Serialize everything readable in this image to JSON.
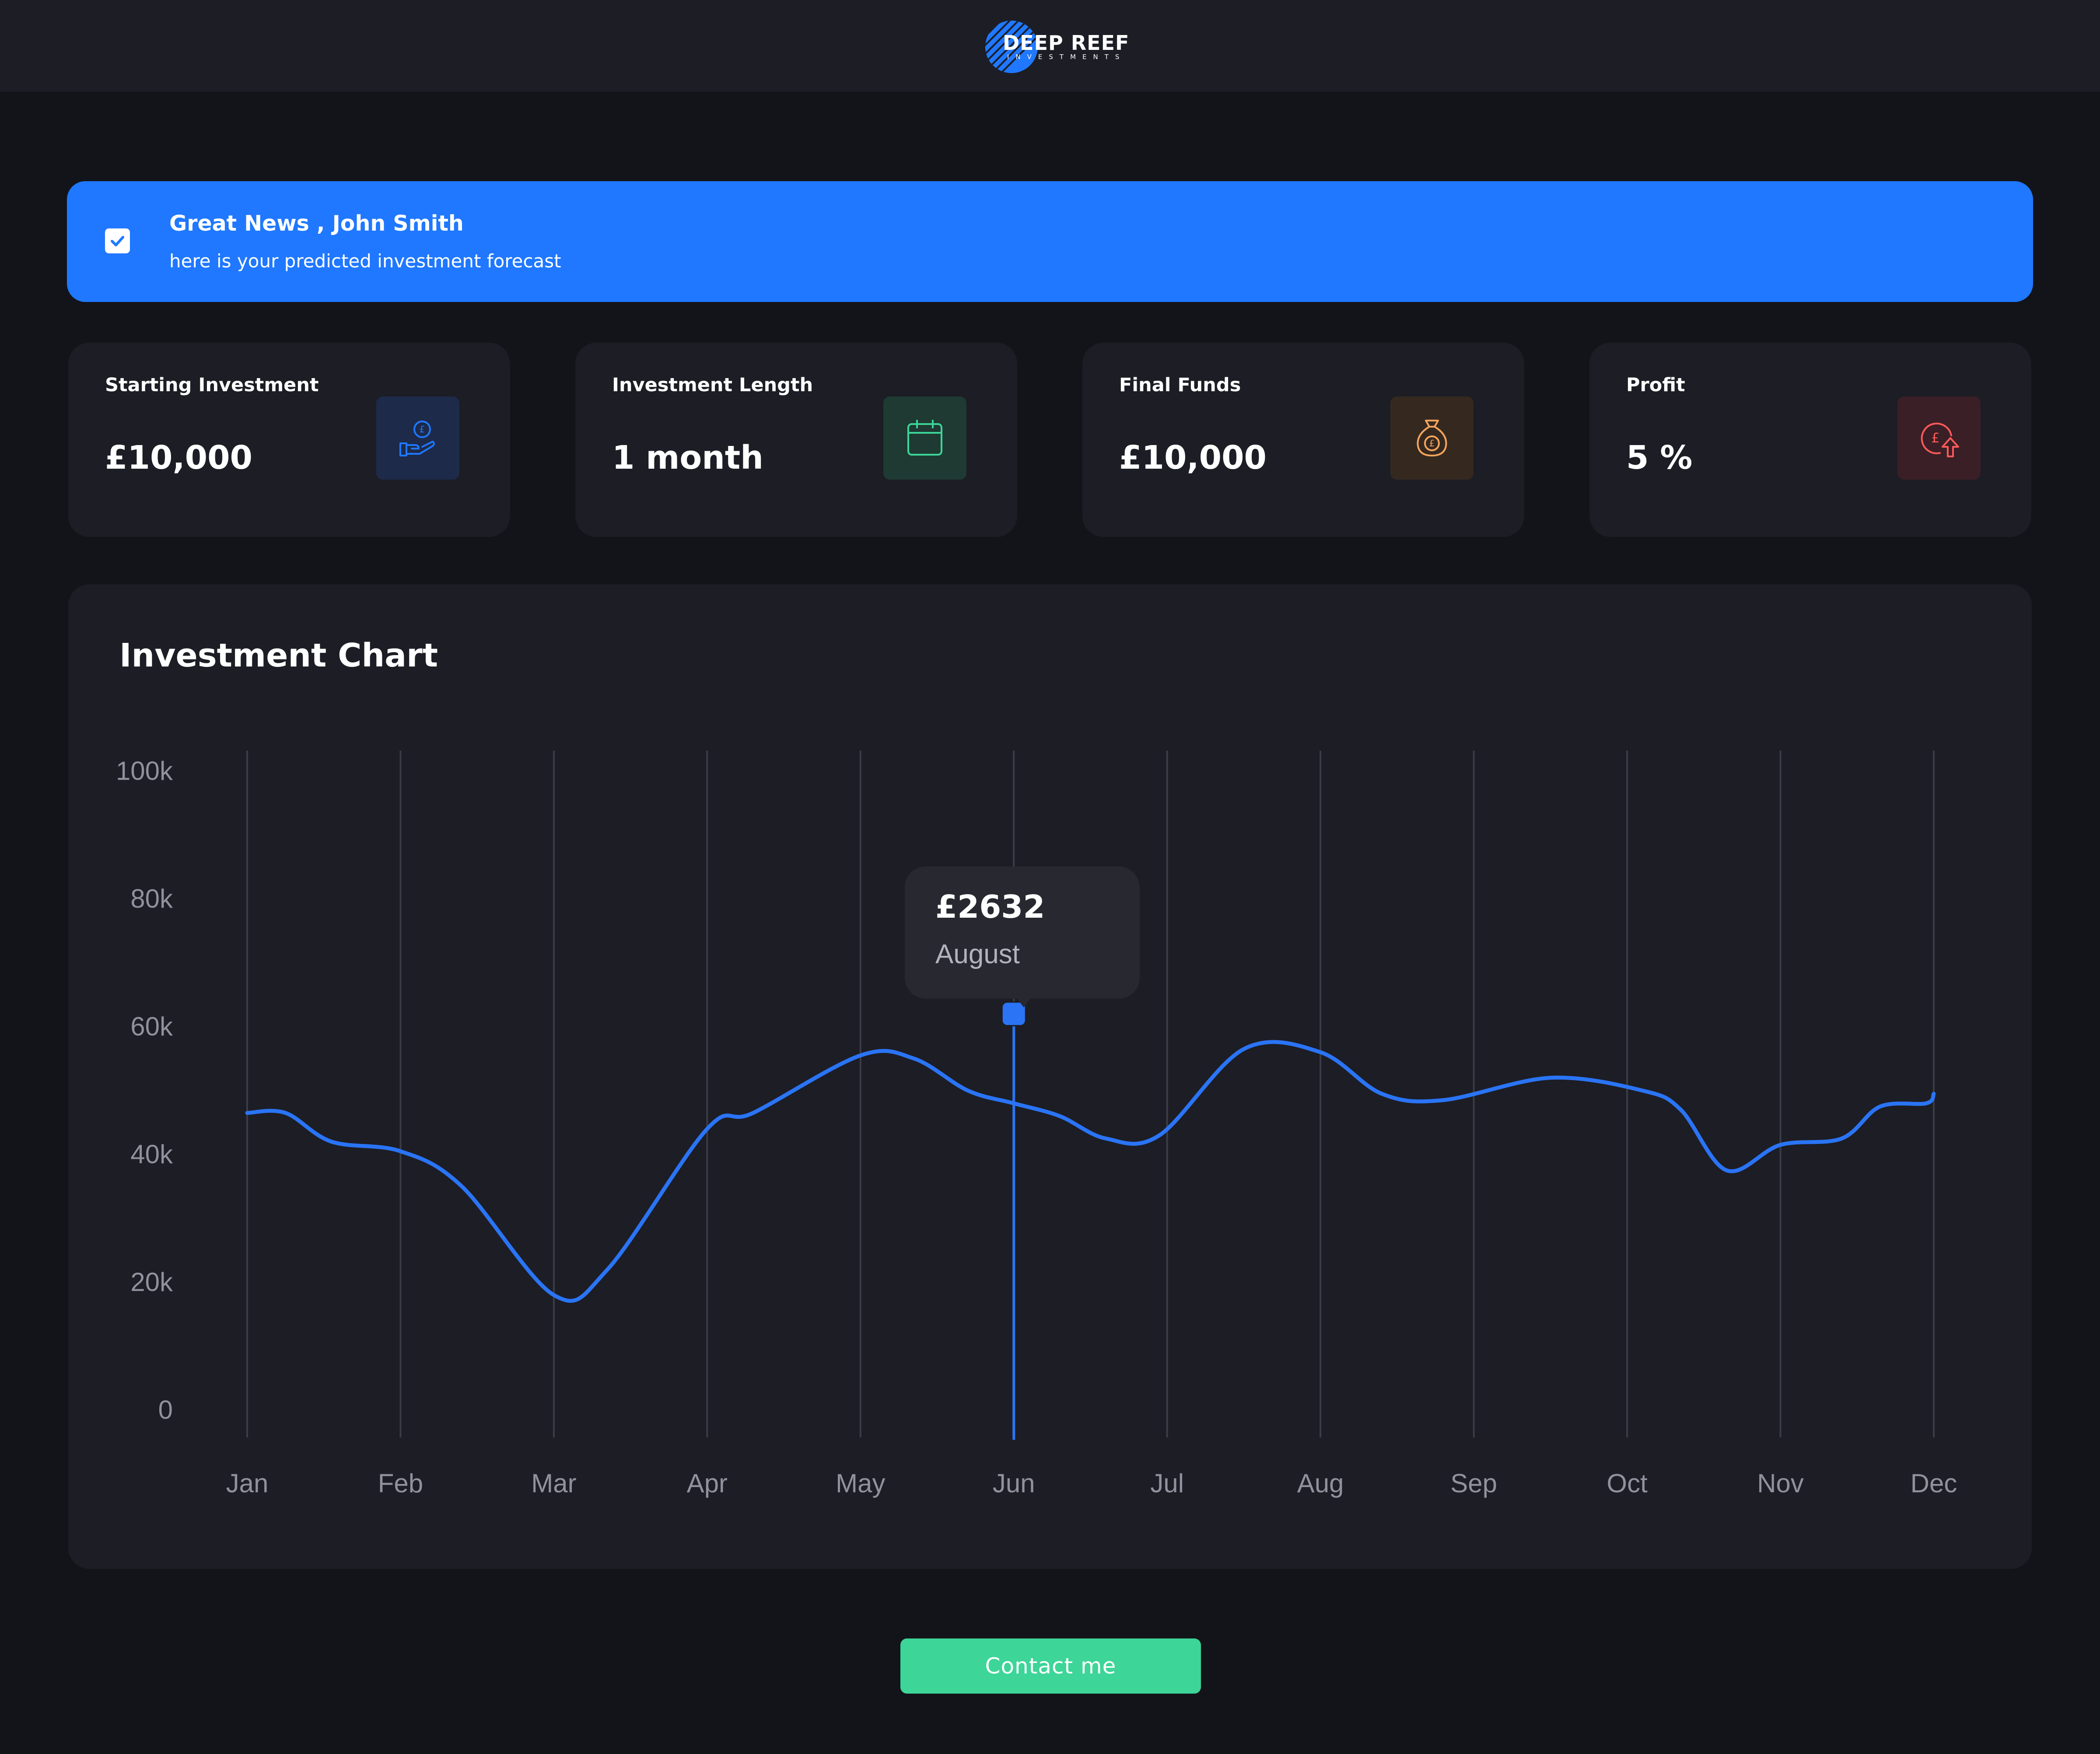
{
  "brand": {
    "name": "DEEP REEF",
    "tagline": "INVESTMENTS",
    "logo_icon": "striped-globe-icon",
    "accent": "#1f78ff"
  },
  "banner": {
    "icon": "checkbox-icon",
    "title": "Great News , John Smith",
    "subtitle": "here is your predicted investment forecast",
    "color": "#1f78ff"
  },
  "stats": [
    {
      "label": "Starting Investment",
      "value": "£10,000",
      "icon": "hand-coin-icon",
      "color": "#1f78ff"
    },
    {
      "label": "Investment Length",
      "value": "1 month",
      "icon": "calendar-icon",
      "color": "#3dd598"
    },
    {
      "label": "Final Funds",
      "value": "£10,000",
      "icon": "money-bag-icon",
      "color": "#f5a45d"
    },
    {
      "label": "Profit",
      "value": "5 %",
      "icon": "pound-arrow-up-icon",
      "color": "#fc5a5a"
    }
  ],
  "chart": {
    "title": "Investment Chart",
    "tooltip": {
      "value": "£2632",
      "month": "August"
    }
  },
  "chart_data": {
    "type": "line",
    "categories": [
      "Jan",
      "Feb",
      "Mar",
      "Apr",
      "May",
      "Jun",
      "Jul",
      "Aug",
      "Sep",
      "Oct",
      "Nov",
      "Dec"
    ],
    "y_ticks": [
      "100k",
      "80k",
      "60k",
      "40k",
      "20k",
      "0"
    ],
    "ylim": [
      0,
      100000
    ],
    "grid": "vertical",
    "series": [
      {
        "color": "#2a74f5",
        "points": [
          [
            0,
            46500
          ],
          [
            0.25,
            46500
          ],
          [
            0.55,
            42000
          ],
          [
            1,
            40500
          ],
          [
            1.4,
            35000
          ],
          [
            2,
            18000
          ],
          [
            2.35,
            22000
          ],
          [
            3,
            44000
          ],
          [
            3.3,
            46500
          ],
          [
            4,
            55500
          ],
          [
            4.35,
            55000
          ],
          [
            4.7,
            50000
          ],
          [
            5,
            48000
          ],
          [
            5.3,
            46000
          ],
          [
            5.6,
            42500
          ],
          [
            5.95,
            43000
          ],
          [
            6.5,
            56500
          ],
          [
            7,
            56000
          ],
          [
            7.4,
            49500
          ],
          [
            7.8,
            48500
          ],
          [
            8.5,
            52000
          ],
          [
            9.1,
            50000
          ],
          [
            9.35,
            47000
          ],
          [
            9.65,
            37500
          ],
          [
            10,
            41500
          ],
          [
            10.4,
            42500
          ],
          [
            10.65,
            47500
          ],
          [
            10.95,
            48000
          ],
          [
            11,
            49500
          ]
        ]
      }
    ],
    "highlight": {
      "x": 5,
      "y": 62000,
      "label": "£2632",
      "sublabel": "August"
    }
  },
  "contact_button": {
    "label": "Contact me",
    "color": "#3dd598"
  }
}
